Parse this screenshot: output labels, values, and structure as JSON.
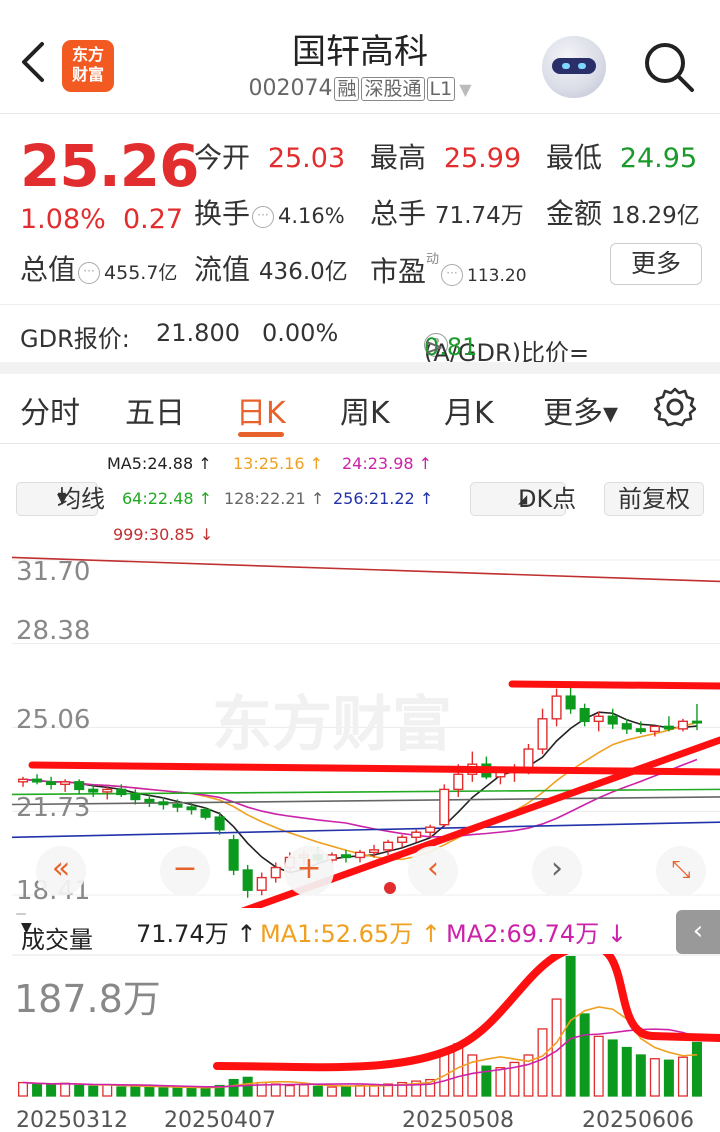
{
  "header": {
    "back_icon": "chevron-left-icon",
    "logo_text": "东方财富",
    "title": "国轩高科",
    "code": "002074",
    "tags": [
      "融",
      "深股通",
      "L1"
    ],
    "search_icon": "search-icon",
    "avatar": "robot-avatar"
  },
  "quote": {
    "price": "25.26",
    "change_pct": "1.08%",
    "change_abs": "0.27",
    "open_label": "今开",
    "open": "25.03",
    "high_label": "最高",
    "high": "25.99",
    "low_label": "最低",
    "low": "24.95",
    "turnover_label": "换手",
    "turnover": "4.16%",
    "volume_label": "总手",
    "volume": "71.74万",
    "amount_label": "金额",
    "amount": "18.29亿",
    "mcap_label": "总值",
    "mcap": "455.7亿",
    "float_label": "流值",
    "float": "436.0亿",
    "pe_label": "市盈",
    "pe_sup": "动",
    "pe": "113.20",
    "more": "更多"
  },
  "gdr": {
    "label": "GDR报价:",
    "price": "21.800",
    "pct": "0.00%",
    "ratio_label": "(A/GDR)比价=",
    "ratio": "0.81",
    "arrow": ">"
  },
  "tabs": [
    {
      "label": "分时"
    },
    {
      "label": "五日"
    },
    {
      "label": "日K"
    },
    {
      "label": "周K"
    },
    {
      "label": "月K"
    },
    {
      "label": "更多▾"
    }
  ],
  "legend": {
    "ma5": "MA5:24.88 ↑",
    "ma13": "13:25.16 ↑",
    "ma24": "24:23.98 ↑",
    "ma64": "64:22.48 ↑",
    "ma128": "128:22.21 ↑",
    "ma256": "256:21.22 ↑",
    "ma999": "999:30.85 ↓",
    "avg_btn": "均线",
    "dk_btn": "DK点",
    "adj_btn": "前复权"
  },
  "chart_data": {
    "type": "candlestick",
    "watermark": "东方财富",
    "y_ticks": [
      "31.70",
      "28.38",
      "25.06",
      "21.73",
      "18.41"
    ],
    "ylim": [
      18.41,
      31.7
    ],
    "ma_colors": {
      "MA5": "#222222",
      "MA13": "#f0a020",
      "MA24": "#cc22aa",
      "MA64": "#22aa22",
      "MA128": "#666666",
      "MA256": "#2233aa",
      "MA999": "#c03030"
    },
    "candles": [
      [
        22.9,
        23.1,
        22.7,
        23.0
      ],
      [
        23.0,
        23.2,
        22.8,
        22.9
      ],
      [
        22.9,
        23.1,
        22.6,
        22.8
      ],
      [
        22.8,
        23.0,
        22.5,
        22.9
      ],
      [
        22.9,
        23.0,
        22.4,
        22.6
      ],
      [
        22.6,
        22.8,
        22.3,
        22.5
      ],
      [
        22.5,
        22.7,
        22.2,
        22.6
      ],
      [
        22.6,
        22.8,
        22.3,
        22.4
      ],
      [
        22.4,
        22.6,
        22.0,
        22.2
      ],
      [
        22.2,
        22.4,
        21.9,
        22.1
      ],
      [
        22.1,
        22.3,
        21.8,
        22.0
      ],
      [
        22.0,
        22.2,
        21.7,
        21.9
      ],
      [
        21.9,
        22.1,
        21.6,
        21.8
      ],
      [
        21.8,
        21.9,
        21.4,
        21.5
      ],
      [
        21.5,
        21.7,
        20.8,
        21.0
      ],
      [
        20.6,
        20.8,
        19.2,
        19.4
      ],
      [
        19.4,
        19.6,
        18.3,
        18.6
      ],
      [
        18.6,
        19.3,
        18.4,
        19.1
      ],
      [
        19.1,
        19.7,
        18.9,
        19.5
      ],
      [
        19.5,
        20.1,
        19.3,
        19.9
      ],
      [
        19.9,
        20.2,
        19.6,
        20.0
      ],
      [
        20.0,
        20.3,
        19.7,
        19.8
      ],
      [
        19.8,
        20.1,
        19.6,
        20.0
      ],
      [
        20.0,
        20.2,
        19.7,
        19.9
      ],
      [
        19.9,
        20.2,
        19.7,
        20.1
      ],
      [
        20.1,
        20.4,
        19.9,
        20.2
      ],
      [
        20.2,
        20.6,
        20.0,
        20.5
      ],
      [
        20.5,
        20.8,
        20.3,
        20.7
      ],
      [
        20.7,
        21.0,
        20.5,
        20.9
      ],
      [
        20.9,
        21.2,
        20.7,
        21.1
      ],
      [
        21.2,
        22.8,
        21.1,
        22.6
      ],
      [
        22.6,
        23.6,
        22.3,
        23.2
      ],
      [
        23.2,
        24.1,
        22.9,
        23.6
      ],
      [
        23.6,
        23.9,
        23.0,
        23.1
      ],
      [
        23.1,
        23.4,
        22.8,
        23.3
      ],
      [
        23.3,
        23.6,
        22.9,
        23.4
      ],
      [
        23.4,
        24.4,
        23.2,
        24.2
      ],
      [
        24.2,
        25.8,
        24.0,
        25.4
      ],
      [
        25.4,
        26.6,
        25.1,
        26.3
      ],
      [
        26.3,
        26.9,
        25.6,
        25.8
      ],
      [
        25.8,
        26.0,
        25.1,
        25.3
      ],
      [
        25.3,
        25.7,
        24.9,
        25.5
      ],
      [
        25.5,
        25.8,
        25.0,
        25.2
      ],
      [
        25.2,
        25.4,
        24.8,
        25.0
      ],
      [
        25.0,
        25.3,
        24.8,
        24.9
      ],
      [
        24.9,
        25.1,
        24.7,
        25.1
      ],
      [
        25.1,
        25.5,
        24.9,
        25.0
      ],
      [
        25.0,
        25.4,
        24.9,
        25.3
      ],
      [
        25.3,
        25.99,
        24.95,
        25.26
      ]
    ],
    "volume": {
      "max_label": "187.8万",
      "values": [
        18,
        16,
        15,
        17,
        14,
        13,
        15,
        12,
        13,
        12,
        11,
        12,
        10,
        11,
        14,
        22,
        25,
        18,
        16,
        14,
        15,
        13,
        12,
        13,
        14,
        15,
        16,
        18,
        20,
        22,
        60,
        70,
        55,
        40,
        38,
        45,
        55,
        90,
        130,
        187,
        110,
        80,
        75,
        65,
        55,
        50,
        48,
        52,
        71.74
      ],
      "ma1_label": "MA1:52.65万 ↑",
      "ma2_label": "MA2:69.74万 ↓"
    },
    "volume_head": {
      "label": "成交量",
      "value": "71.74万 ↑"
    },
    "dates": [
      "20250312",
      "20250407",
      "20250508",
      "20250606"
    ]
  }
}
